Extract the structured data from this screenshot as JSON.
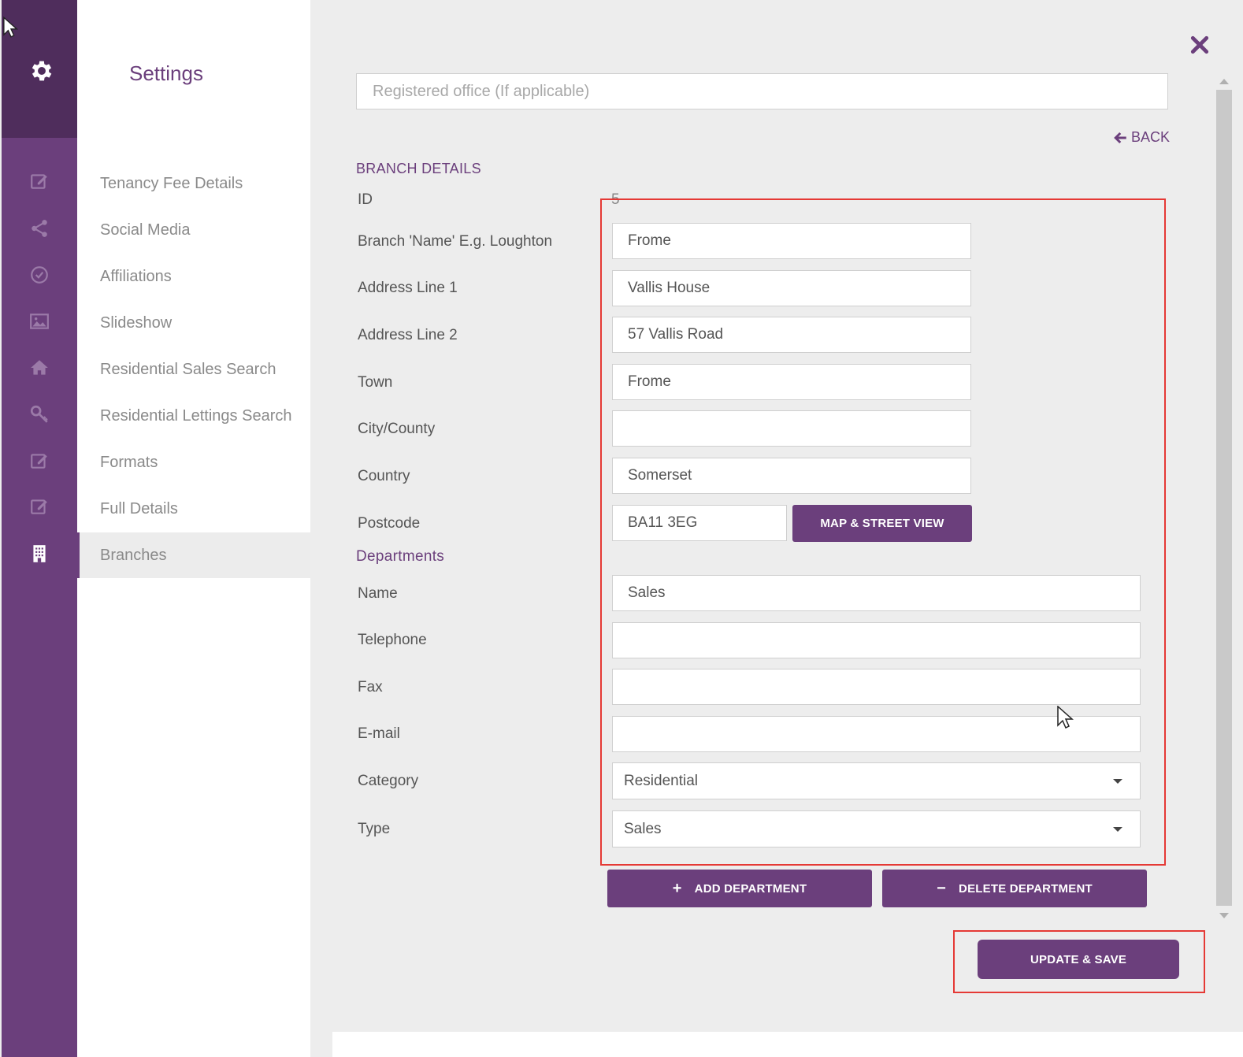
{
  "sidebar": {
    "title": "Settings",
    "icons": [
      "gear-icon",
      "edit-icon",
      "share-icon",
      "check-circle-icon",
      "image-icon",
      "home-icon",
      "key-icon",
      "edit-icon",
      "edit-icon",
      "building-icon"
    ],
    "items": [
      {
        "label": "Tenancy Fee Details"
      },
      {
        "label": "Social Media"
      },
      {
        "label": "Affiliations"
      },
      {
        "label": "Slideshow"
      },
      {
        "label": "Residential Sales Search"
      },
      {
        "label": "Residential Lettings Search"
      },
      {
        "label": "Formats"
      },
      {
        "label": "Full Details"
      },
      {
        "label": "Branches"
      }
    ],
    "active_item": "Branches"
  },
  "main": {
    "registered_office_placeholder": "Registered office (If applicable)",
    "back_label": "BACK",
    "branch_details_title": "BRANCH DETAILS",
    "id_label": "ID",
    "id_value": "5",
    "fields": {
      "branch_name": {
        "label": "Branch 'Name' E.g. Loughton",
        "value": "Frome"
      },
      "address1": {
        "label": "Address Line 1",
        "value": "Vallis House"
      },
      "address2": {
        "label": "Address Line 2",
        "value": "57 Vallis Road"
      },
      "town": {
        "label": "Town",
        "value": "Frome"
      },
      "city": {
        "label": "City/County",
        "value": ""
      },
      "country": {
        "label": "Country",
        "value": "Somerset"
      },
      "postcode": {
        "label": "Postcode",
        "value": "BA11 3EG"
      }
    },
    "map_button": "MAP & STREET VIEW",
    "departments_title": "Departments",
    "dept": {
      "name": {
        "label": "Name",
        "value": "Sales"
      },
      "telephone": {
        "label": "Telephone",
        "value": ""
      },
      "fax": {
        "label": "Fax",
        "value": ""
      },
      "email": {
        "label": "E-mail",
        "value": ""
      },
      "category": {
        "label": "Category",
        "value": "Residential"
      },
      "type": {
        "label": "Type",
        "value": "Sales"
      }
    },
    "add_department": "ADD DEPARTMENT",
    "delete_department": "DELETE DEPARTMENT",
    "update_save": "UPDATE & SAVE"
  },
  "colors": {
    "brand": "#6b3f7c",
    "brand_dark": "#4f2d5c",
    "highlight": "#e53935"
  }
}
